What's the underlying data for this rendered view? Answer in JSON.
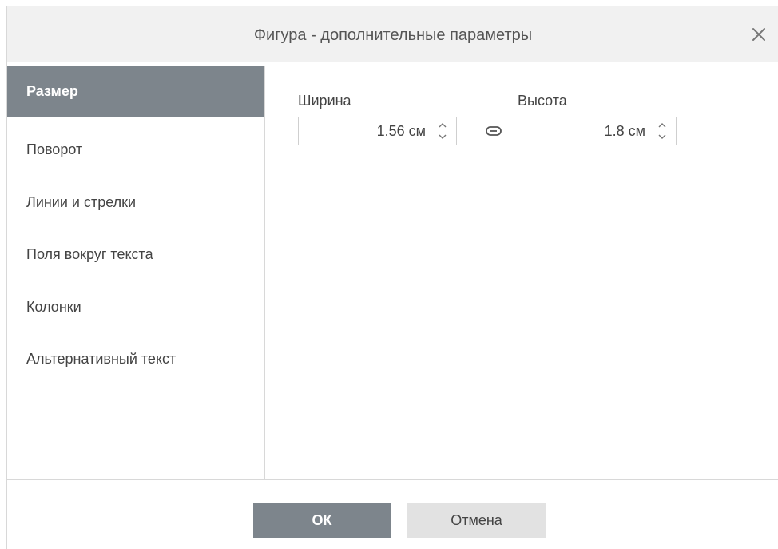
{
  "dialog": {
    "title": "Фигура - дополнительные параметры",
    "close_icon": "close-icon"
  },
  "sidebar": {
    "items": [
      {
        "label": "Размер",
        "active": true
      },
      {
        "label": "Поворот",
        "active": false
      },
      {
        "label": "Линии и стрелки",
        "active": false
      },
      {
        "label": "Поля вокруг текста",
        "active": false
      },
      {
        "label": "Колонки",
        "active": false
      },
      {
        "label": "Альтернативный текст",
        "active": false
      }
    ]
  },
  "size": {
    "width_label": "Ширина",
    "width_value": "1.56 см",
    "height_label": "Высота",
    "height_value": "1.8 см",
    "link_icon": "link-icon"
  },
  "footer": {
    "ok_label": "ОК",
    "cancel_label": "Отмена"
  },
  "colors": {
    "accent": "#7d858c",
    "titlebar_bg": "#f1f1f1",
    "cancel_bg": "#e2e2e2",
    "border": "#d8d8d8"
  }
}
